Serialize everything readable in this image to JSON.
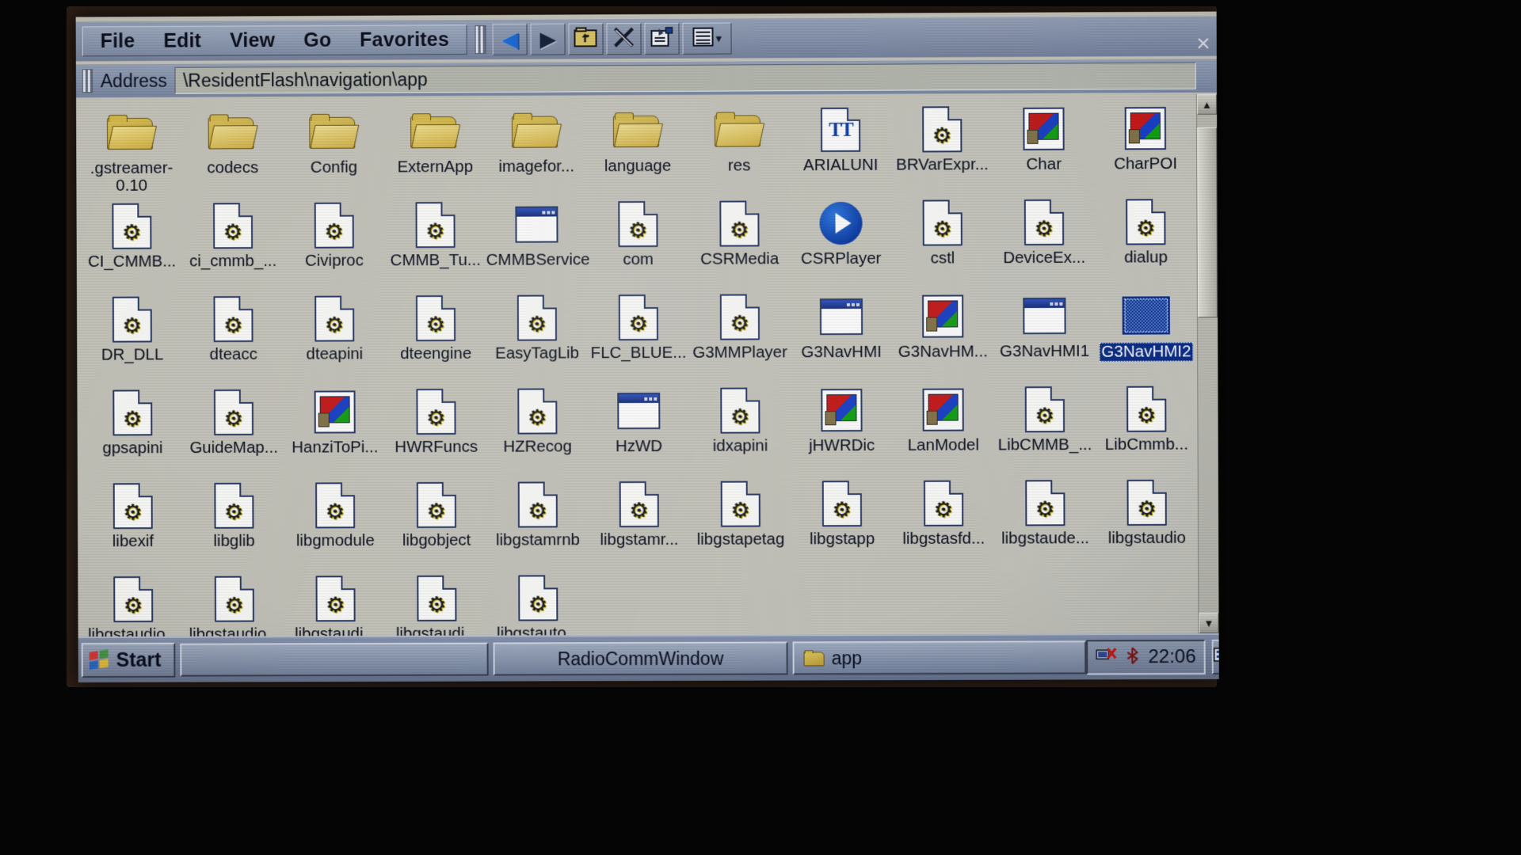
{
  "window": {
    "close_label": "×",
    "menu": [
      {
        "label": "File"
      },
      {
        "label": "Edit"
      },
      {
        "label": "View"
      },
      {
        "label": "Go"
      },
      {
        "label": "Favorites"
      }
    ],
    "toolbar": [
      {
        "name": "back-button",
        "icon": "back-arrow-icon",
        "glyph": "◀"
      },
      {
        "name": "forward-button",
        "icon": "forward-arrow-icon",
        "glyph": "▶"
      },
      {
        "name": "up-folder-button",
        "icon": "up-folder-icon",
        "glyph": ""
      },
      {
        "name": "delete-button",
        "icon": "delete-x-icon",
        "glyph": "✕"
      },
      {
        "name": "properties-button",
        "icon": "properties-icon",
        "glyph": ""
      },
      {
        "name": "view-mode-button",
        "icon": "list-view-icon",
        "glyph": "",
        "caret": "▾"
      }
    ]
  },
  "address": {
    "label": "Address",
    "value": "\\ResidentFlash\\navigation\\app"
  },
  "scrollbar": {
    "up_glyph": "▲",
    "down_glyph": "▼"
  },
  "files": [
    {
      "label": ".gstreamer-0.10",
      "type": "folder",
      "selected": false,
      "two_line": true
    },
    {
      "label": "codecs",
      "type": "folder",
      "selected": false
    },
    {
      "label": "Config",
      "type": "folder",
      "selected": false
    },
    {
      "label": "ExternApp",
      "type": "folder",
      "selected": false
    },
    {
      "label": "imagefor...",
      "type": "folder",
      "selected": false
    },
    {
      "label": "language",
      "type": "folder",
      "selected": false
    },
    {
      "label": "res",
      "type": "folder",
      "selected": false
    },
    {
      "label": "ARIALUNI",
      "type": "font",
      "selected": false
    },
    {
      "label": "BRVarExpr...",
      "type": "dll",
      "selected": false
    },
    {
      "label": "Char",
      "type": "exe",
      "selected": false
    },
    {
      "label": "CharPOI",
      "type": "exe",
      "selected": false
    },
    {
      "label": "CI_CMMB...",
      "type": "dll",
      "selected": false
    },
    {
      "label": "ci_cmmb_...",
      "type": "dll",
      "selected": false
    },
    {
      "label": "Civiproc",
      "type": "dll",
      "selected": false
    },
    {
      "label": "CMMB_Tu...",
      "type": "dll",
      "selected": false
    },
    {
      "label": "CMMBService",
      "type": "winapp",
      "selected": false
    },
    {
      "label": "com",
      "type": "dll",
      "selected": false
    },
    {
      "label": "CSRMedia",
      "type": "dll",
      "selected": false
    },
    {
      "label": "CSRPlayer",
      "type": "player",
      "selected": false
    },
    {
      "label": "cstl",
      "type": "dll",
      "selected": false
    },
    {
      "label": "DeviceEx...",
      "type": "dll",
      "selected": false
    },
    {
      "label": "dialup",
      "type": "dll",
      "selected": false
    },
    {
      "label": "DR_DLL",
      "type": "dll",
      "selected": false
    },
    {
      "label": "dteacc",
      "type": "dll",
      "selected": false
    },
    {
      "label": "dteapini",
      "type": "dll",
      "selected": false
    },
    {
      "label": "dteengine",
      "type": "dll",
      "selected": false
    },
    {
      "label": "EasyTagLib",
      "type": "dll",
      "selected": false
    },
    {
      "label": "FLC_BLUE...",
      "type": "dll",
      "selected": false
    },
    {
      "label": "G3MMPlayer",
      "type": "dll",
      "selected": false
    },
    {
      "label": "G3NavHMI",
      "type": "winapp",
      "selected": false
    },
    {
      "label": "G3NavHM...",
      "type": "exe",
      "selected": false
    },
    {
      "label": "G3NavHMI1",
      "type": "winapp",
      "selected": false
    },
    {
      "label": "G3NavHMI2",
      "type": "selected-tile",
      "selected": true
    },
    {
      "label": "gpsapini",
      "type": "dll",
      "selected": false
    },
    {
      "label": "GuideMap...",
      "type": "dll",
      "selected": false
    },
    {
      "label": "HanziToPi...",
      "type": "exe",
      "selected": false
    },
    {
      "label": "HWRFuncs",
      "type": "dll",
      "selected": false
    },
    {
      "label": "HZRecog",
      "type": "dll",
      "selected": false
    },
    {
      "label": "HzWD",
      "type": "winapp",
      "selected": false
    },
    {
      "label": "idxapini",
      "type": "dll",
      "selected": false
    },
    {
      "label": "jHWRDic",
      "type": "exe",
      "selected": false
    },
    {
      "label": "LanModel",
      "type": "exe",
      "selected": false
    },
    {
      "label": "LibCMMB_...",
      "type": "dll",
      "selected": false
    },
    {
      "label": "LibCmmb...",
      "type": "dll",
      "selected": false
    },
    {
      "label": "libexif",
      "type": "dll",
      "selected": false
    },
    {
      "label": "libglib",
      "type": "dll",
      "selected": false
    },
    {
      "label": "libgmodule",
      "type": "dll",
      "selected": false
    },
    {
      "label": "libgobject",
      "type": "dll",
      "selected": false
    },
    {
      "label": "libgstamrnb",
      "type": "dll",
      "selected": false
    },
    {
      "label": "libgstamr...",
      "type": "dll",
      "selected": false
    },
    {
      "label": "libgstapetag",
      "type": "dll",
      "selected": false
    },
    {
      "label": "libgstapp",
      "type": "dll",
      "selected": false
    },
    {
      "label": "libgstasfd...",
      "type": "dll",
      "selected": false
    },
    {
      "label": "libgstaude...",
      "type": "dll",
      "selected": false
    },
    {
      "label": "libgstaudio",
      "type": "dll",
      "selected": false
    },
    {
      "label": "libgstaudio...",
      "type": "dll",
      "selected": false
    },
    {
      "label": "libgstaudio...",
      "type": "dll",
      "selected": false
    },
    {
      "label": "libgstaudi...",
      "type": "dll",
      "selected": false
    },
    {
      "label": "libgstaudi...",
      "type": "dll",
      "selected": false
    },
    {
      "label": "libgstauto...",
      "type": "dll",
      "selected": false
    }
  ],
  "taskbar": {
    "start_label": "Start",
    "buttons": [
      {
        "name": "taskbar-button-empty",
        "label": "",
        "icon": ""
      },
      {
        "name": "taskbar-button-radiocomm",
        "label": "RadioCommWindow",
        "icon": ""
      },
      {
        "name": "taskbar-button-app",
        "label": "app",
        "icon": "folder-icon"
      }
    ],
    "tray": {
      "icons": [
        "network-disconnected-icon",
        "bluetooth-icon"
      ],
      "clock": "22:06"
    },
    "right_buttons": [
      {
        "name": "keyboard-toggle-button",
        "icon": "keyboard-icon",
        "glyph": "⌨"
      },
      {
        "name": "stylus-input-button",
        "icon": "pen-icon",
        "glyph": "✎"
      }
    ]
  }
}
